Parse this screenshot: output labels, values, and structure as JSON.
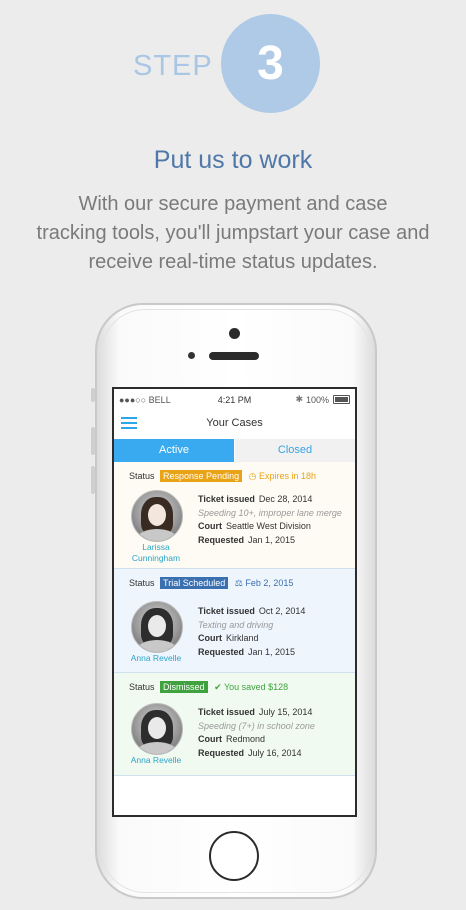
{
  "step": {
    "label": "STEP",
    "number": "3"
  },
  "headline": "Put us to work",
  "description_lines": [
    "With our secure payment and case",
    "tracking tools, you'll jumpstart your case and",
    "receive real-time status updates."
  ],
  "status_bar": {
    "carrier": "●●●○○ BELL",
    "time": "4:21 PM",
    "battery": "100%"
  },
  "nav": {
    "title": "Your Cases"
  },
  "tabs": {
    "active": "Active",
    "closed": "Closed"
  },
  "cases": [
    {
      "status_label": "Status",
      "badge": "Response Pending",
      "badge_color": "#e8a317",
      "extra": "Expires in 18h",
      "extra_color": "#e8a317",
      "bg": "#fdfbf3",
      "name": "Larissa Cunningham",
      "ticket_label": "Ticket issued",
      "ticket_date": "Dec 28, 2014",
      "violation": "Speeding 10+, improper lane merge",
      "court_label": "Court",
      "court": "Seattle West Division",
      "requested_label": "Requested",
      "requested": "Jan 1, 2015"
    },
    {
      "status_label": "Status",
      "badge": "Trial Scheduled",
      "badge_color": "#3a6fb0",
      "extra": "Feb 2, 2015",
      "extra_color": "#3a6fb0",
      "bg": "#eef5fd",
      "name": "Anna Revelle",
      "ticket_label": "Ticket issued",
      "ticket_date": "Oct 2, 2014",
      "violation": "Texting and driving",
      "court_label": "Court",
      "court": "Kirkland",
      "requested_label": "Requested",
      "requested": "Jan 1, 2015"
    },
    {
      "status_label": "Status",
      "badge": "Dismissed",
      "badge_color": "#3fa23f",
      "extra": "You saved $128",
      "extra_color": "#3fa23f",
      "bg": "#f1faf1",
      "name": "Anna Revelle",
      "ticket_label": "Ticket issued",
      "ticket_date": "July 15, 2014",
      "violation": "Speeding (7+) in school zone",
      "court_label": "Court",
      "court": "Redmond",
      "requested_label": "Requested",
      "requested": "July 16, 2014"
    }
  ],
  "icons": {
    "menu": "hamburger-icon",
    "clock": "clock-icon",
    "gavel": "gavel-icon",
    "check": "checkmark-icon"
  }
}
